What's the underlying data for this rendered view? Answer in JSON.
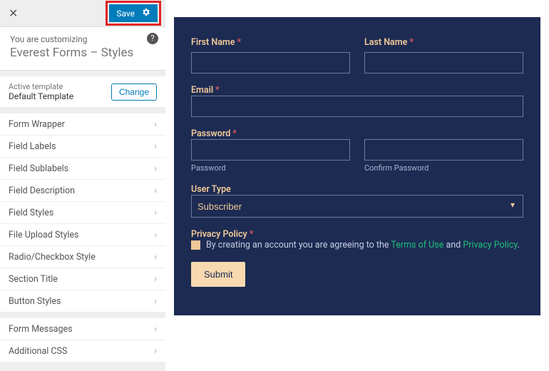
{
  "topbar": {
    "save_label": "Save"
  },
  "heading": {
    "small": "You are customizing",
    "big": "Everest Forms – Styles"
  },
  "template": {
    "label": "Active template",
    "value": "Default Template",
    "change": "Change"
  },
  "panels_a": [
    {
      "label": "Form Wrapper"
    },
    {
      "label": "Field Labels"
    },
    {
      "label": "Field Sublabels"
    },
    {
      "label": "Field Description"
    },
    {
      "label": "Field Styles"
    },
    {
      "label": "File Upload Styles"
    },
    {
      "label": "Radio/Checkbox Style"
    },
    {
      "label": "Section Title"
    },
    {
      "label": "Button Styles"
    }
  ],
  "panels_b": [
    {
      "label": "Form Messages"
    },
    {
      "label": "Additional CSS"
    }
  ],
  "form": {
    "first_name": "First Name",
    "last_name": "Last Name",
    "email": "Email",
    "password": "Password",
    "password_sub": "Password",
    "confirm_sub": "Confirm Password",
    "user_type": "User Type",
    "user_type_value": "Subscriber",
    "privacy": "Privacy Policy",
    "policy_pre": "By creating an account you are agreeing to the ",
    "policy_tou": "Terms of Use",
    "policy_and": " and ",
    "policy_pp": "Privacy Policy",
    "policy_dot": ".",
    "submit": "Submit"
  }
}
